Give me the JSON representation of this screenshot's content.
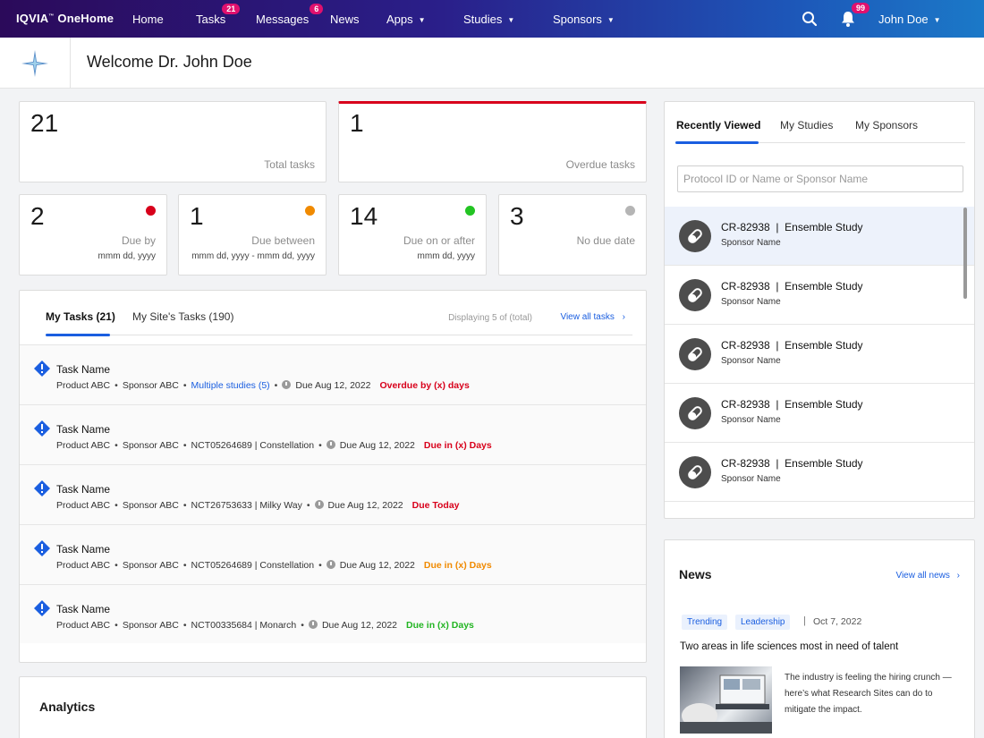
{
  "nav": {
    "brand": "IQVIA",
    "brand_mark": "™",
    "brand_product": "OneHome",
    "items": [
      {
        "label": "Home"
      },
      {
        "label": "Tasks",
        "badge": "21"
      },
      {
        "label": "Messages",
        "badge": "6"
      },
      {
        "label": "News"
      },
      {
        "label": "Apps",
        "dropdown": true
      },
      {
        "label": "Studies",
        "dropdown": true
      },
      {
        "label": "Sponsors",
        "dropdown": true
      }
    ],
    "notifications_badge": "99",
    "user": "John Doe"
  },
  "welcome": {
    "title": "Welcome Dr. John Doe"
  },
  "summary": {
    "total": {
      "value": "21",
      "label": "Total tasks"
    },
    "overdue": {
      "value": "1",
      "label": "Overdue tasks",
      "accent": "#d8001b"
    }
  },
  "due_cards": [
    {
      "value": "2",
      "label": "Due by",
      "sub": "mmm dd, yyyy",
      "dot": "#d8001b"
    },
    {
      "value": "1",
      "label": "Due between",
      "sub": "mmm dd, yyyy - mmm dd, yyyy",
      "dot": "#f08a00"
    },
    {
      "value": "14",
      "label": "Due on or after",
      "sub": "mmm dd, yyyy",
      "dot": "#23c423"
    },
    {
      "value": "3",
      "label": "No due date",
      "sub": "",
      "dot": "#b5b5b5"
    }
  ],
  "tasks": {
    "tab_mine": "My Tasks (21)",
    "tab_site": "My Site's Tasks (190)",
    "displaying": "Displaying 5 of (total)",
    "view_all": "View all tasks",
    "rows": [
      {
        "name": "Task Name",
        "product": "Product ABC",
        "sponsor": "Sponsor ABC",
        "study": "Multiple studies (5)",
        "study_link": true,
        "due": "Due Aug 12, 2022",
        "status": "Overdue by (x) days",
        "status_type": "red"
      },
      {
        "name": "Task Name",
        "product": "Product ABC",
        "sponsor": "Sponsor ABC",
        "study": "NCT05264689 | Constellation",
        "study_link": false,
        "due": "Due Aug 12, 2022",
        "status": "Due in (x) Days",
        "status_type": "red"
      },
      {
        "name": "Task Name",
        "product": "Product ABC",
        "sponsor": "Sponsor ABC",
        "study": "NCT26753633 | Milky Way",
        "study_link": false,
        "due": "Due Aug 12, 2022",
        "status": "Due Today",
        "status_type": "red"
      },
      {
        "name": "Task Name",
        "product": "Product ABC",
        "sponsor": "Sponsor ABC",
        "study": "NCT05264689 | Constellation",
        "study_link": false,
        "due": "Due Aug 12, 2022",
        "status": "Due in (x) Days",
        "status_type": "orange"
      },
      {
        "name": "Task Name",
        "product": "Product ABC",
        "sponsor": "Sponsor ABC",
        "study": "NCT00335684 | Monarch",
        "study_link": false,
        "due": "Due Aug 12, 2022",
        "status": "Due in (x) Days",
        "status_type": "green"
      }
    ]
  },
  "analytics": {
    "title": "Analytics"
  },
  "recent": {
    "tabs": [
      "Recently Viewed",
      "My Studies",
      "My Sponsors"
    ],
    "search_placeholder": "Protocol ID or Name or Sponsor Name",
    "items": [
      {
        "id": "CR-82938",
        "study": "Ensemble Study",
        "sponsor": "Sponsor Name"
      },
      {
        "id": "CR-82938",
        "study": "Ensemble Study",
        "sponsor": "Sponsor Name"
      },
      {
        "id": "CR-82938",
        "study": "Ensemble Study",
        "sponsor": "Sponsor Name"
      },
      {
        "id": "CR-82938",
        "study": "Ensemble Study",
        "sponsor": "Sponsor Name"
      },
      {
        "id": "CR-82938",
        "study": "Ensemble Study",
        "sponsor": "Sponsor Name"
      }
    ]
  },
  "news": {
    "title": "News",
    "view_all": "View all news",
    "tags": [
      "Trending",
      "Leadership"
    ],
    "date": "Oct 7, 2022",
    "headline": "Two areas in life sciences most in need of talent",
    "summary": "The industry is feeling the hiring crunch — here’s what Research Sites can do to mitigate the impact."
  }
}
